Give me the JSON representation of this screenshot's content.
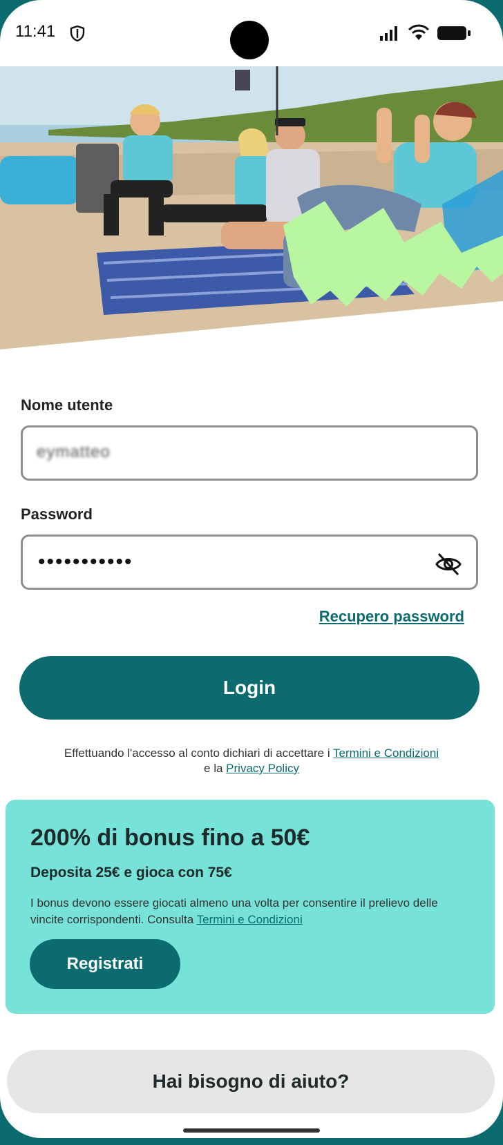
{
  "status_bar": {
    "time": "11:41"
  },
  "form": {
    "username_label": "Nome utente",
    "username_value": "eymatteo",
    "password_label": "Password",
    "password_value": "•••••••••••",
    "recover_link": "Recupero password",
    "login_button": "Login",
    "terms_prefix": "Effettuando l'accesso al conto dichiari di accettare i",
    "terms_link": "Termini e Condizioni",
    "terms_mid": "e la",
    "privacy_link": "Privacy Policy"
  },
  "bonus": {
    "title": "200% di bonus fino a 50€",
    "subtitle": "Deposita 25€ e gioca con 75€",
    "description": "I bonus devono essere giocati almeno una volta per consentire il prelievo delle vincite corrispondenti. Consulta",
    "terms_link": "Termini e Condizioni",
    "register_button": "Registrati"
  },
  "help_button": "Hai bisogno di aiuto?",
  "colors": {
    "primary": "#0b6b6e",
    "bonus_bg": "#76e2d8",
    "accent_green": "#b8f7a0"
  },
  "icons": [
    "shield-icon",
    "signal-icon",
    "wifi-icon",
    "battery-icon",
    "eye-slash-icon"
  ]
}
